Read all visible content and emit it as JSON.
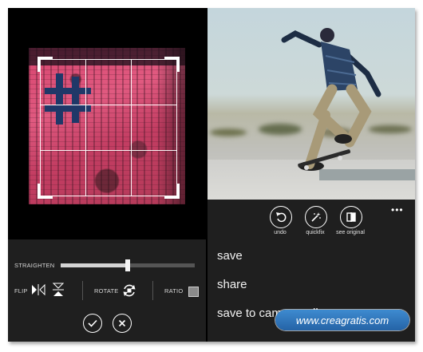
{
  "editor": {
    "straighten_label": "STRAIGHTEN",
    "straighten_value": 0.5,
    "flip_label": "FLIP",
    "rotate_label": "ROTATE",
    "ratio_label": "RATIO",
    "flip_horizontal_icon": "flip-horizontal-icon",
    "flip_vertical_icon": "flip-vertical-icon",
    "rotate_icon": "rotate-icon",
    "ratio_icon": "ratio-icon",
    "confirm_icon": "checkmark-icon",
    "cancel_icon": "close-icon"
  },
  "actions": [
    {
      "label": "undo",
      "icon": "undo-icon"
    },
    {
      "label": "quickfix",
      "icon": "magic-wand-icon"
    },
    {
      "label": "see original",
      "icon": "compare-icon"
    }
  ],
  "more_label": "•••",
  "menu": [
    {
      "label": "save"
    },
    {
      "label": "share"
    },
    {
      "label": "save to camera roll"
    }
  ],
  "watermark": "www.creagratis.com",
  "colors": {
    "panel_bg": "#1f1f1f",
    "screen_bg": "#000000",
    "watermark_blue": "#2d6fb8",
    "text": "#f2f2f2"
  }
}
